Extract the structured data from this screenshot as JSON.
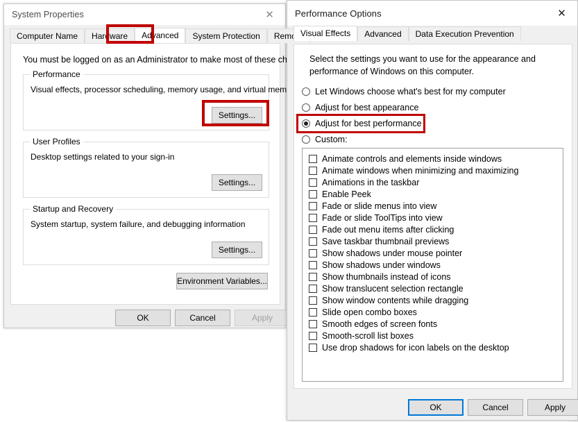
{
  "system_properties": {
    "title": "System Properties",
    "close_icon": "close-icon",
    "tabs": [
      {
        "label": "Computer Name",
        "selected": false
      },
      {
        "label": "Hardware",
        "selected": false
      },
      {
        "label": "Advanced",
        "selected": true
      },
      {
        "label": "System Protection",
        "selected": false
      },
      {
        "label": "Remote",
        "selected": false
      }
    ],
    "admin_notice": "You must be logged on as an Administrator to make most of these changes.",
    "groups": [
      {
        "title": "Performance",
        "description": "Visual effects, processor scheduling, memory usage, and virtual memory",
        "button": "Settings..."
      },
      {
        "title": "User Profiles",
        "description": "Desktop settings related to your sign-in",
        "button": "Settings..."
      },
      {
        "title": "Startup and Recovery",
        "description": "System startup, system failure, and debugging information",
        "button": "Settings..."
      }
    ],
    "environment_variables_button": "Environment Variables...",
    "footer": {
      "ok": "OK",
      "cancel": "Cancel",
      "apply": "Apply"
    }
  },
  "performance_options": {
    "title": "Performance Options",
    "close_icon": "close-icon",
    "tabs": [
      {
        "label": "Visual Effects",
        "selected": true
      },
      {
        "label": "Advanced",
        "selected": false
      },
      {
        "label": "Data Execution Prevention",
        "selected": false
      }
    ],
    "intro_line1": "Select the settings you want to use for the appearance and",
    "intro_line2": "performance of Windows on this computer.",
    "radios": [
      {
        "label": "Let Windows choose what's best for my computer",
        "checked": false
      },
      {
        "label": "Adjust for best appearance",
        "checked": false
      },
      {
        "label": "Adjust for best performance",
        "checked": true
      },
      {
        "label": "Custom:",
        "checked": false
      }
    ],
    "effects": [
      {
        "label": "Animate controls and elements inside windows",
        "checked": false
      },
      {
        "label": "Animate windows when minimizing and maximizing",
        "checked": false
      },
      {
        "label": "Animations in the taskbar",
        "checked": false
      },
      {
        "label": "Enable Peek",
        "checked": false
      },
      {
        "label": "Fade or slide menus into view",
        "checked": false
      },
      {
        "label": "Fade or slide ToolTips into view",
        "checked": false
      },
      {
        "label": "Fade out menu items after clicking",
        "checked": false
      },
      {
        "label": "Save taskbar thumbnail previews",
        "checked": false
      },
      {
        "label": "Show shadows under mouse pointer",
        "checked": false
      },
      {
        "label": "Show shadows under windows",
        "checked": false
      },
      {
        "label": "Show thumbnails instead of icons",
        "checked": false
      },
      {
        "label": "Show translucent selection rectangle",
        "checked": false
      },
      {
        "label": "Show window contents while dragging",
        "checked": false
      },
      {
        "label": "Slide open combo boxes",
        "checked": false
      },
      {
        "label": "Smooth edges of screen fonts",
        "checked": false
      },
      {
        "label": "Smooth-scroll list boxes",
        "checked": false
      },
      {
        "label": "Use drop shadows for icon labels on the desktop",
        "checked": false
      }
    ],
    "footer": {
      "ok": "OK",
      "cancel": "Cancel",
      "apply": "Apply"
    }
  },
  "annotations": {
    "highlight_color": "#c00000",
    "boxes": [
      {
        "name": "advanced-tab-highlight"
      },
      {
        "name": "performance-settings-button-highlight"
      },
      {
        "name": "adjust-best-performance-highlight"
      }
    ]
  }
}
